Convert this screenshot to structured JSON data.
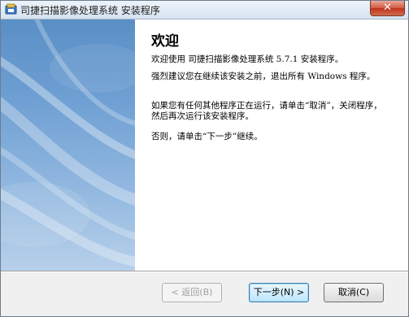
{
  "window": {
    "title": "司捷扫描影像处理系统 安装程序",
    "close_label": "✕"
  },
  "content": {
    "heading": "欢迎",
    "paragraphs": [
      "欢迎使用 司捷扫描影像处理系统 5.7.1 安装程序。",
      "强烈建议您在继续该安装之前，退出所有 Windows 程序。",
      "如果您有任何其他程序正在运行，请单击“取消”，关闭程序，然后再次运行该安装程序。",
      "否则，请单击“下一步”继续。"
    ]
  },
  "buttons": {
    "back": "< 返回(B)",
    "next": "下一步(N) >",
    "cancel": "取消(C)"
  },
  "colors": {
    "sidebar_top": "#5a8fc6",
    "sidebar_bottom": "#b7d0ea",
    "close_button": "#c1321d"
  }
}
